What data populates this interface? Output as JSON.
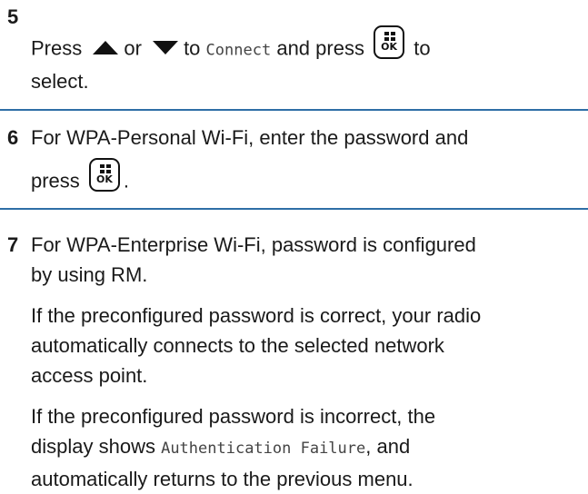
{
  "steps": [
    {
      "number": "5",
      "text": {
        "press": "Press",
        "or": "or",
        "to": "to",
        "menu_item": "Connect",
        "and_press": "and press",
        "to_end": "to",
        "select": "select."
      }
    },
    {
      "number": "6",
      "text": {
        "line1": "For WPA-Personal Wi-Fi, enter the password and",
        "press": "press",
        "period": "."
      }
    },
    {
      "number": "7",
      "text": {
        "line1": "For WPA-Enterprise Wi-Fi, password is configured",
        "line2": "by using RM.",
        "para2_l1": "If the preconfigured password is correct, your radio",
        "para2_l2": "automatically connects to the selected network",
        "para2_l3": "access point.",
        "para3_l1": "If the preconfigured password is incorrect, the",
        "para3_display": "display shows",
        "para3_msg": "Authentication Failure",
        "para3_after": ", and",
        "para3_l3": "automatically returns to the previous menu."
      }
    }
  ],
  "icons": {
    "up": "up-arrow-icon",
    "down": "down-arrow-icon",
    "ok": "menu-ok-key-icon"
  },
  "ok_key_label": "OK",
  "colors": {
    "divider": "#2e6ea6"
  }
}
